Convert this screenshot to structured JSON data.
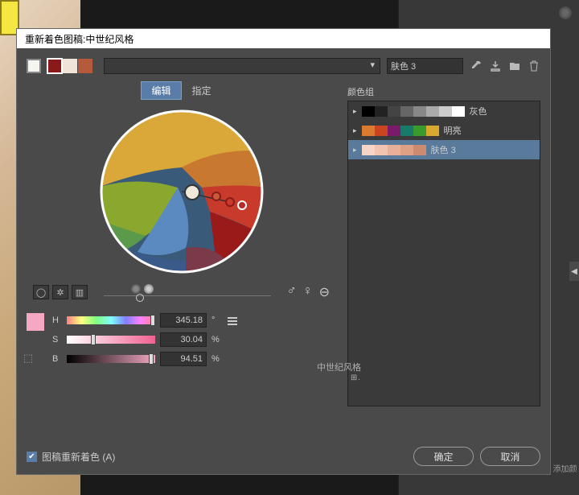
{
  "title_prefix": "重新着色图稿: ",
  "title_doc": "中世纪风格",
  "preset_name": "肤色 3",
  "top_swatches": [
    "#8a1a1a",
    "#f0e4d8",
    "#b55a3a"
  ],
  "tabs": {
    "edit": "编辑",
    "assign": "指定"
  },
  "groups_label": "颜色组",
  "groups": [
    {
      "name": "灰色",
      "colors": [
        "#000",
        "#222",
        "#444",
        "#666",
        "#888",
        "#aaa",
        "#ccc",
        "#fff"
      ]
    },
    {
      "name": "明亮",
      "colors": [
        "#d97a2e",
        "#c9441f",
        "#7a1a6a",
        "#1a7a6a",
        "#3a9a2e",
        "#d9a82e"
      ]
    },
    {
      "name": "肤色 3",
      "colors": [
        "#f5d5c8",
        "#f0c4b0",
        "#e8b098",
        "#dda085",
        "#cc8a70"
      ]
    }
  ],
  "hsb": {
    "h": "345.18",
    "s": "30.04",
    "b": "94.51"
  },
  "source_name": "中世纪风格",
  "checkbox_label": "图稿重新着色 (A)",
  "buttons": {
    "ok": "确定",
    "cancel": "取消"
  },
  "sidebar_label": "添加颜"
}
